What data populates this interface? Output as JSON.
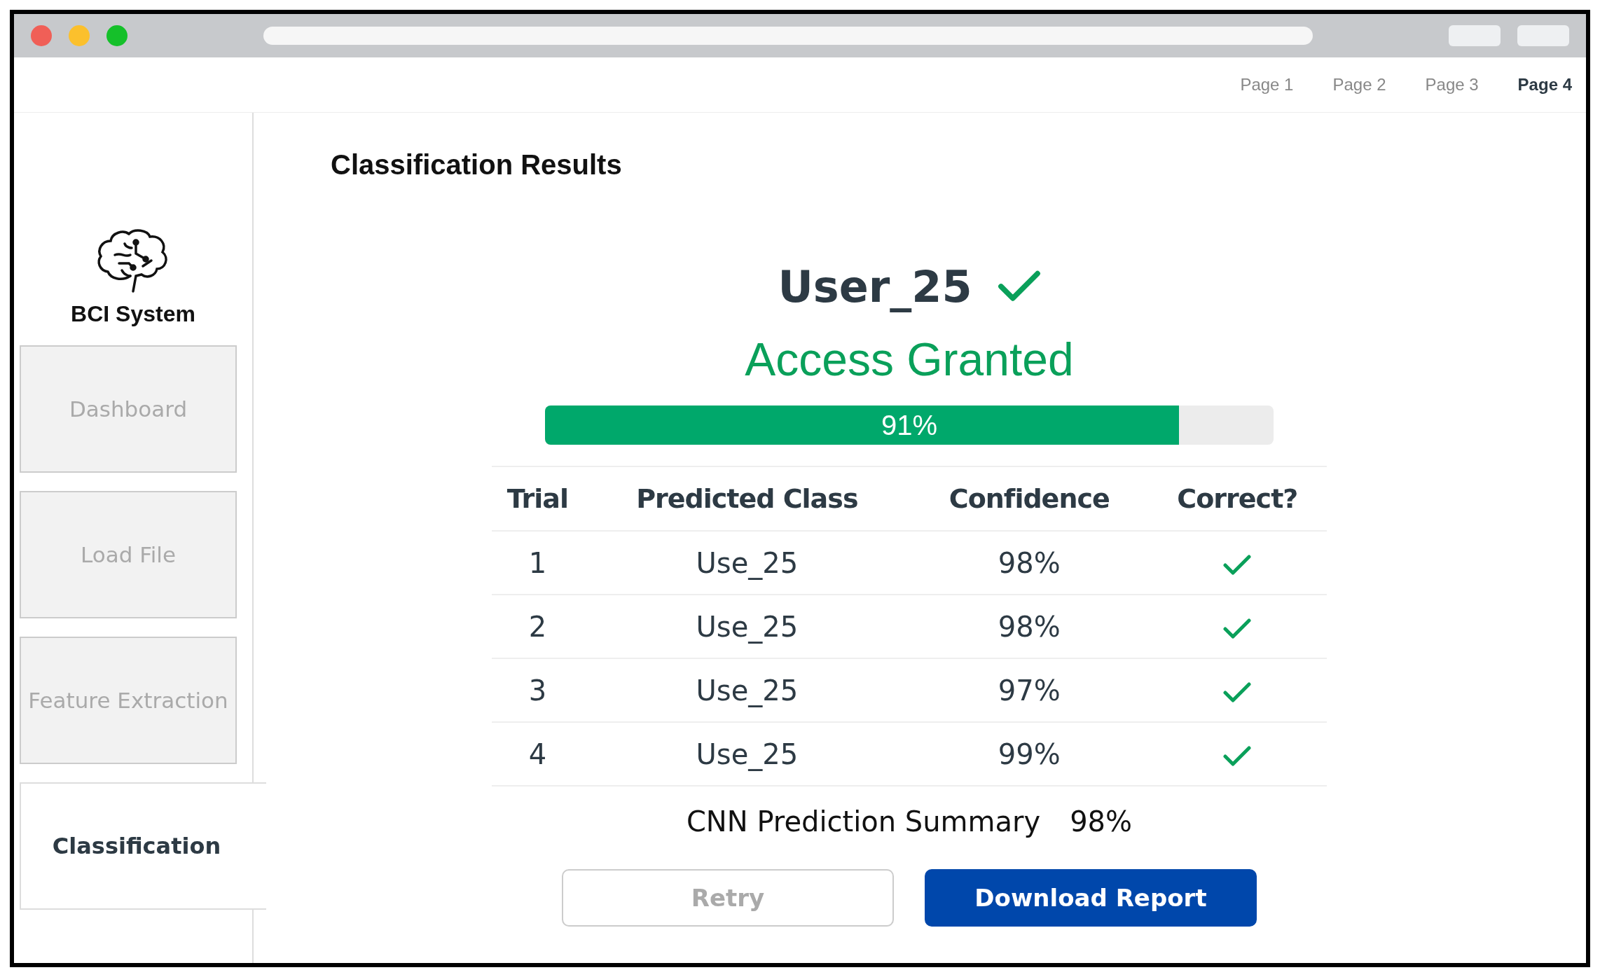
{
  "nav": [
    {
      "label": "Page 1",
      "selected": false
    },
    {
      "label": "Page 2",
      "selected": false
    },
    {
      "label": "Page 3",
      "selected": false
    },
    {
      "label": "Page 4",
      "selected": true
    }
  ],
  "sidebar": {
    "logo": "BCI System",
    "items": [
      {
        "label": "Dashboard",
        "selected": false
      },
      {
        "label": "Load File",
        "selected": false
      },
      {
        "label": "Feature Extraction",
        "selected": false
      },
      {
        "label": "Classification",
        "selected": true
      }
    ]
  },
  "title": "Classification Results",
  "result": {
    "user": "User_25",
    "verified": true,
    "status": "Access Granted",
    "level": 0.87,
    "reading": "91%"
  },
  "table": {
    "columns": [
      "Trial",
      "Predicted Class",
      "Confidence",
      "Correct?"
    ],
    "rows": [
      {
        "trial": "1",
        "predicted": "Use_25",
        "confidence": "98%",
        "correct": true
      },
      {
        "trial": "2",
        "predicted": "Use_25",
        "confidence": "98%",
        "correct": true
      },
      {
        "trial": "3",
        "predicted": "Use_25",
        "confidence": "97%",
        "correct": true
      },
      {
        "trial": "4",
        "predicted": "Use_25",
        "confidence": "99%",
        "correct": true
      }
    ]
  },
  "summary": {
    "label": "CNN Prediction Summary",
    "value": "98%"
  },
  "buttons": [
    {
      "label": "Retry",
      "kind": "secondary"
    },
    {
      "label": "Download Report",
      "kind": "primary"
    }
  ]
}
